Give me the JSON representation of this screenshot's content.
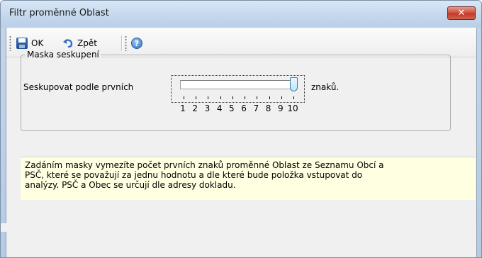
{
  "window": {
    "title": "Filtr proměnné Oblast",
    "close_glyph": "✕"
  },
  "toolbar": {
    "ok_label": "OK",
    "back_label": "Zpět"
  },
  "group": {
    "legend": "Maska seskupení",
    "label": "Seskupovat podle prvních",
    "suffix": "znaků.",
    "slider": {
      "min": 1,
      "max": 10,
      "value": 10,
      "ticks": [
        "1",
        "2",
        "3",
        "4",
        "5",
        "6",
        "7",
        "8",
        "9",
        "10"
      ]
    }
  },
  "info": {
    "text": "Zadáním masky vymezíte počet prvních znaků proměnné Oblast ze Seznamu Obcí a\nPSČ, které se považují za jednu hodnotu a dle které bude položka vstupovat do\nanalýzy. PSČ a Obec se určují dle adresy dokladu."
  },
  "icons": {
    "save": "save-icon",
    "undo": "undo-icon",
    "help": "help-icon"
  },
  "colors": {
    "info_background": "#ffffe1",
    "close_button": "#c0392b"
  }
}
